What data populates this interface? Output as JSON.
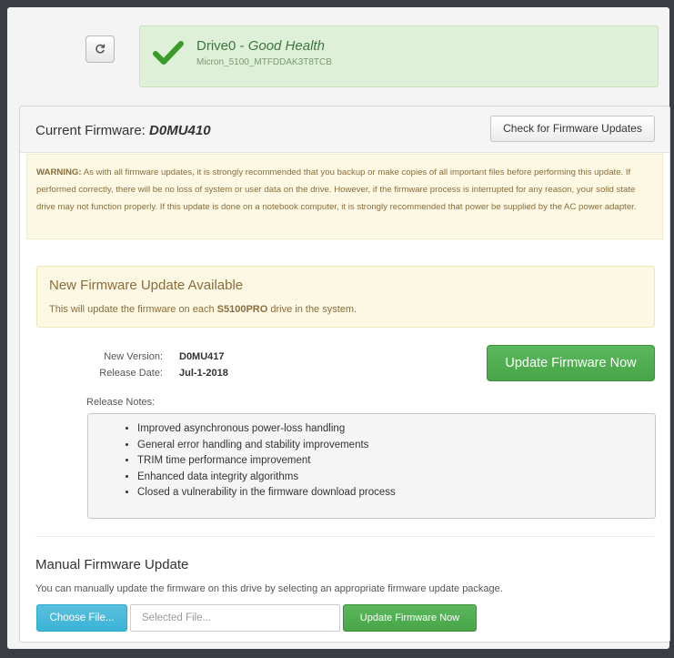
{
  "drive": {
    "name_prefix": "Drive0 - ",
    "health": "Good Health",
    "model": "Micron_5100_MTFDDAK3T8TCB"
  },
  "icons": {
    "refresh": "refresh-icon",
    "health": "checkmark-icon"
  },
  "colors": {
    "health_green": "#dff0d8",
    "checkmark": "#3a9a2a",
    "warning_bg": "#fcf8e3",
    "primary_green": "#5cb85c",
    "info_blue": "#5bc0de"
  },
  "firmware": {
    "current_label": "Current Firmware: ",
    "current_version": "D0MU410",
    "check_updates_label": "Check for Firmware Updates"
  },
  "warning": {
    "label": "WARNING:",
    "text": " As with all firmware updates, it is strongly recommended that you backup or make copies of all important files before performing this update. If performed correctly, there will be no loss of system or user data on the drive. However, if the firmware process is interrupted for any reason, your solid state drive may not function properly. If this update is done on a notebook computer, it is strongly recommended that power be supplied by the AC power adapter."
  },
  "update": {
    "title": "New Firmware Update Available",
    "desc_prefix": "This will update the firmware on each ",
    "model": "S5100PRO",
    "desc_suffix": " drive in the system.",
    "new_version_label": "New Version:",
    "new_version": "D0MU417",
    "release_date_label": "Release Date:",
    "release_date": "Jul-1-2018",
    "update_button": "Update Firmware Now",
    "notes_label": "Release Notes:",
    "notes": [
      "Improved asynchronous power-loss handling",
      "General error handling and stability improvements",
      "TRIM time performance improvement",
      "Enhanced data integrity algorithms",
      "Closed a vulnerability in the firmware download process"
    ]
  },
  "manual": {
    "title": "Manual Firmware Update",
    "description": "You can manually update the firmware on this drive by selecting an appropriate firmware update package.",
    "choose_file": "Choose File...",
    "file_placeholder": "Selected File...",
    "update_button": "Update Firmware Now"
  }
}
